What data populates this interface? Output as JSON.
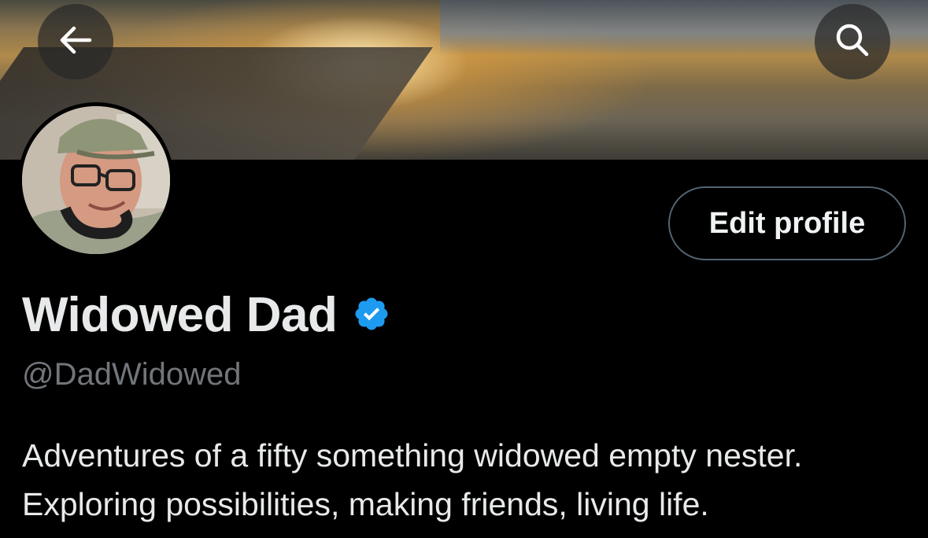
{
  "profile": {
    "edit_button_label": "Edit profile",
    "display_name": "Widowed Dad",
    "handle": "@DadWidowed",
    "bio_lines": [
      "Adventures of a fifty something widowed empty nester.",
      "Exploring possibilities, making friends, living life."
    ]
  },
  "icons": {
    "back": "arrow-left-icon",
    "search": "search-icon",
    "verified": "verified-badge-icon"
  },
  "colors": {
    "background": "#000000",
    "verified": "#1d9bf0",
    "handle_text": "#71767b",
    "button_border": "#536471"
  }
}
